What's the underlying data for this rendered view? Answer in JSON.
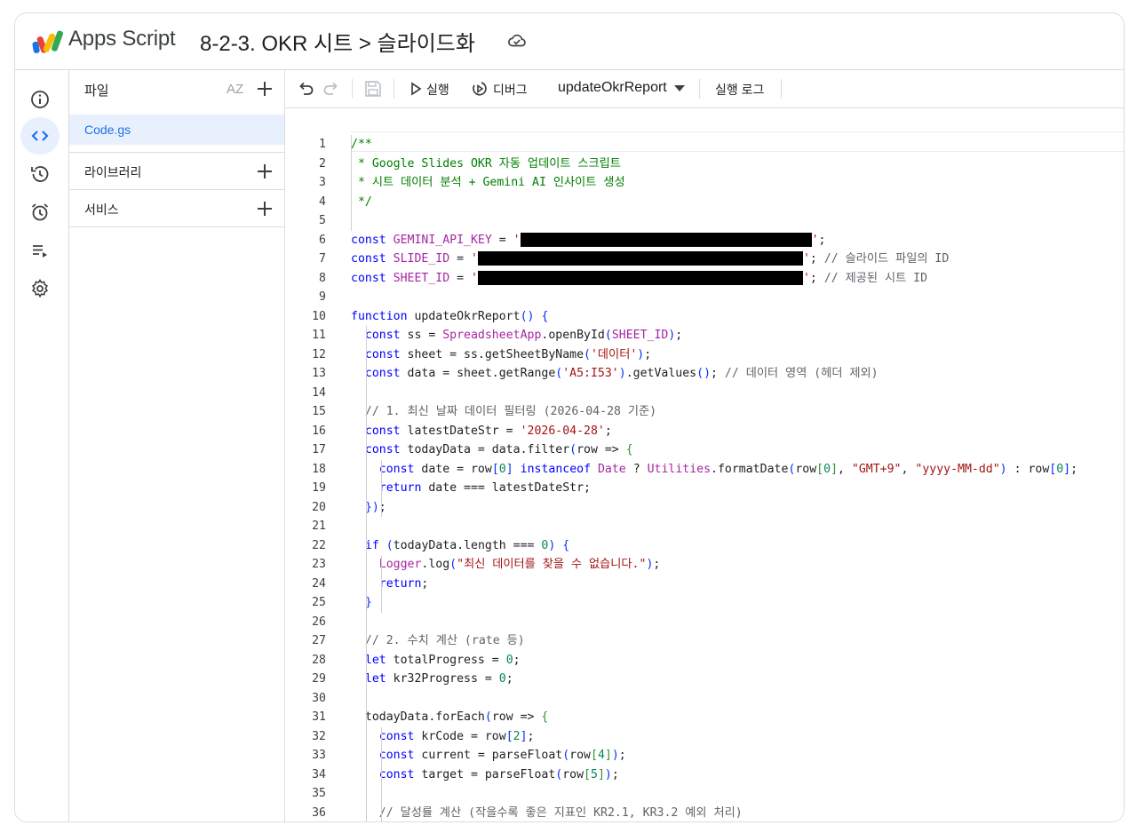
{
  "header": {
    "app_name": "Apps Script",
    "project_title": "8-2-3. OKR 시트 > 슬라이드화"
  },
  "rail": {
    "items": [
      {
        "icon": "info-icon",
        "label": "개요"
      },
      {
        "icon": "code-icon",
        "label": "편집기"
      },
      {
        "icon": "history-icon",
        "label": "프로젝트 기록"
      },
      {
        "icon": "alarm-icon",
        "label": "트리거"
      },
      {
        "icon": "executions-icon",
        "label": "실행"
      },
      {
        "icon": "gear-icon",
        "label": "프로젝트 설정"
      }
    ]
  },
  "files_panel": {
    "title": "파일",
    "sort_icon_text": "AZ",
    "files": [
      {
        "name": "Code.gs"
      }
    ],
    "sections": [
      {
        "title": "라이브러리"
      },
      {
        "title": "서비스"
      }
    ]
  },
  "toolbar": {
    "run_label": "실행",
    "debug_label": "디버그",
    "function_name": "updateOkrReport",
    "log_label": "실행 로그"
  },
  "editor": {
    "code_lines": [
      "/**",
      " * Google Slides OKR 자동 업데이트 스크립트",
      " * 시트 데이터 분석 + Gemini AI 인사이트 생성",
      " */",
      "",
      "const GEMINI_API_KEY = '█';",
      "const SLIDE_ID = '█'; // 슬라이드 파일의 ID",
      "const SHEET_ID = '█'; // 제공된 시트 ID",
      "",
      "function updateOkrReport() {",
      "  const ss = SpreadsheetApp.openById(SHEET_ID);",
      "  const sheet = ss.getSheetByName('데이터');",
      "  const data = sheet.getRange('A5:I53').getValues(); // 데이터 영역 (헤더 제외)",
      "",
      "  // 1. 최신 날짜 데이터 필터링 (2026-04-28 기준)",
      "  const latestDateStr = '2026-04-28';",
      "  const todayData = data.filter(row => {",
      "    const date = row[0] instanceof Date ? Utilities.formatDate(row[0], \"GMT+9\", \"yyyy-MM-dd\") : row[0];",
      "    return date === latestDateStr;",
      "  });",
      "",
      "  if (todayData.length === 0) {",
      "    Logger.log(\"최신 데이터를 찾을 수 없습니다.\");",
      "    return;",
      "  }",
      "",
      "  // 2. 수치 계산 (rate 등)",
      "  let totalProgress = 0;",
      "  let kr32Progress = 0;",
      "",
      "  todayData.forEach(row => {",
      "    const krCode = row[2];",
      "    const current = parseFloat(row[4]);",
      "    const target = parseFloat(row[5]);",
      "",
      "    // 달성률 계산 (작을수록 좋은 지표인 KR2.1, KR3.2 예외 처리)"
    ]
  }
}
